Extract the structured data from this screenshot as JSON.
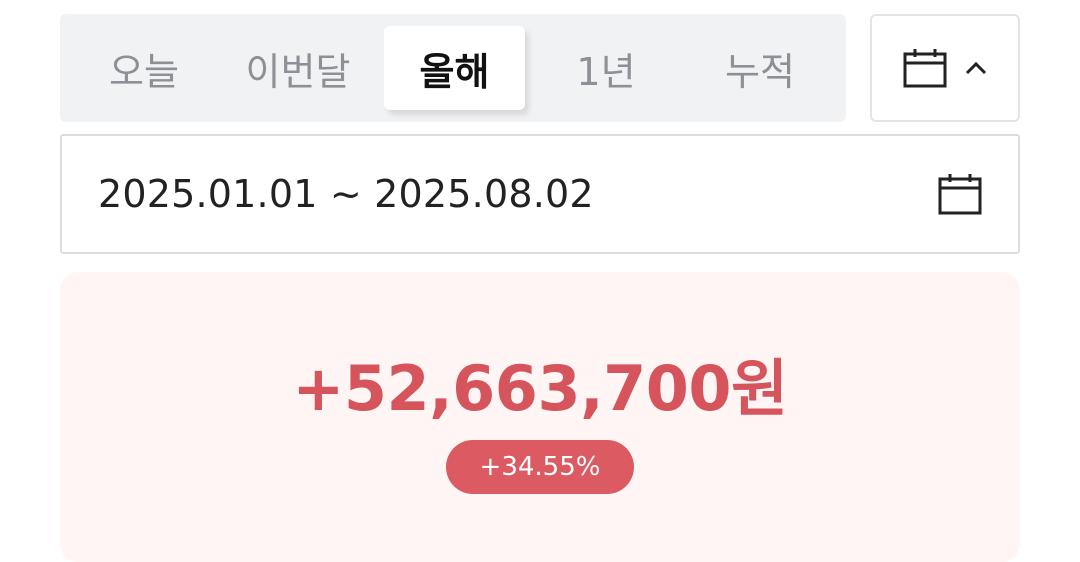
{
  "period_tabs": [
    {
      "label": "오늘",
      "active": false
    },
    {
      "label": "이번달",
      "active": false
    },
    {
      "label": "올해",
      "active": true
    },
    {
      "label": "1년",
      "active": false
    },
    {
      "label": "누적",
      "active": false
    }
  ],
  "calendar_toggle": {
    "icon": "calendar-icon",
    "chevron": "chevron-up-icon"
  },
  "date_range": {
    "text": "2025.01.01 ~ 2025.08.02",
    "icon": "calendar-icon"
  },
  "summary": {
    "amount": "+52,663,700원",
    "percent": "+34.55%",
    "colors": {
      "amount": "#d6555d",
      "badge_bg": "#dc5a62",
      "card_bg": "#fff5f5"
    }
  }
}
